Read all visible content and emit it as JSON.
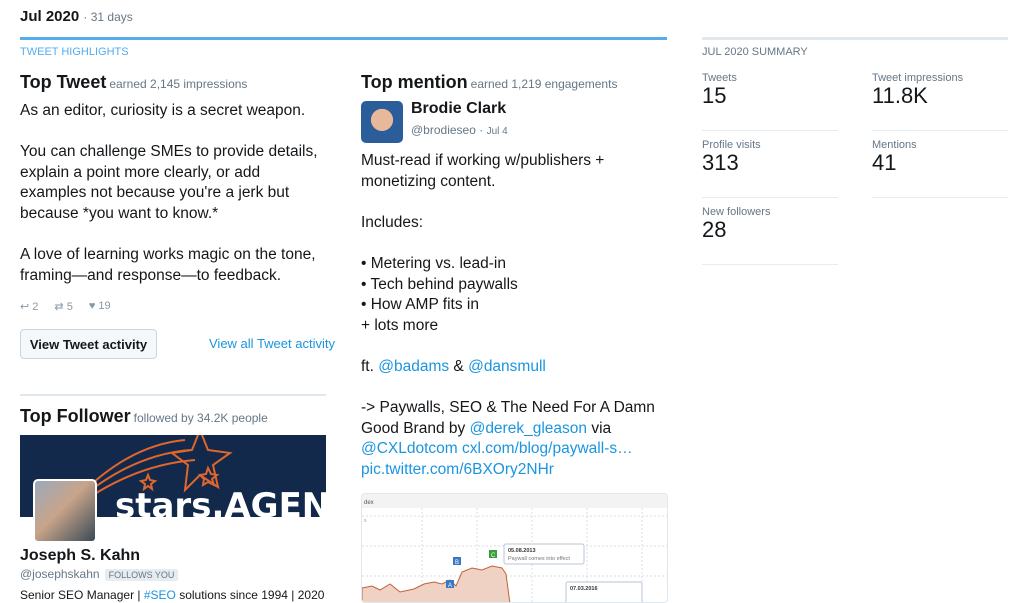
{
  "header": {
    "period": "Jul 2020",
    "days": "31 days"
  },
  "highlights": {
    "label": "TWEET HIGHLIGHTS"
  },
  "top_tweet": {
    "title": "Top Tweet",
    "sub": "earned 2,145 impressions",
    "paragraphs": [
      "As an editor, curiosity is a secret weapon.",
      "You can challenge SMEs to provide details, explain a point more clearly, or add examples not because you're a jerk but because *you want to know.*",
      "A love of learning works magic on the tone, framing—and response—to feedback."
    ],
    "replies": "2",
    "retweets": "5",
    "likes": "19",
    "view_button": "View Tweet activity",
    "view_all": "View all Tweet activity"
  },
  "top_follower": {
    "title": "Top Follower",
    "sub": "followed by 34.2K people",
    "banner_text": "stars.AGENCY",
    "name": "Joseph S. Kahn",
    "handle": "@josephskahn",
    "follows_you": "FOLLOWS YOU",
    "bio_start": "Senior SEO Manager | ",
    "bio_tag": "#SEO",
    "bio_end": " solutions since 1994 | 2020"
  },
  "top_mention": {
    "title": "Top mention",
    "sub": "earned 1,219 engagements",
    "name": "Brodie Clark",
    "handle": "@brodieseo",
    "date": "Jul 4",
    "p1": "Must-read if working w/publishers + monetizing content.",
    "p2": "Includes:",
    "bullets": [
      "• Metering vs. lead-in",
      "• Tech behind paywalls",
      "• How AMP fits in",
      "+ lots more"
    ],
    "ft": "ft. ",
    "m1": "@badams",
    "amp": " & ",
    "m2": "@dansmull",
    "p4a": "-> Paywalls, SEO & The Need For A Damn Good Brand by ",
    "m3": "@derek_gleason",
    "via": " via ",
    "m4": "@CXLdotcom",
    "url1": "cxl.com/blog/paywall-s…",
    "url2": "pic.twitter.com/6BXOry2NHr",
    "embed": {
      "title": "dex",
      "axis": "s",
      "note1_date": "05.08.2013",
      "note1_text": "Paywall comes into effect",
      "note2_date": "07.03.2016",
      "markers": [
        "A",
        "B",
        "C"
      ]
    }
  },
  "summary": {
    "label": "JUL 2020 SUMMARY",
    "items": [
      {
        "label": "Tweets",
        "value": "15"
      },
      {
        "label": "Tweet impressions",
        "value": "11.8K"
      },
      {
        "label": "Profile visits",
        "value": "313"
      },
      {
        "label": "Mentions",
        "value": "41"
      },
      {
        "label": "New followers",
        "value": "28"
      }
    ]
  },
  "colors": {
    "accent": "#55acee",
    "link": "#1b95e0",
    "banner": "#13294b",
    "star": "#e0662b"
  }
}
